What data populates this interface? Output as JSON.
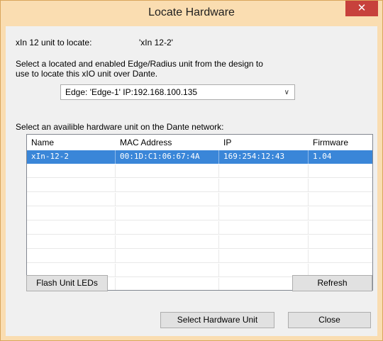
{
  "window": {
    "title": "Locate Hardware",
    "close_glyph": "✕",
    "frame_color": "#faddb1",
    "selection_color": "#3a86d8"
  },
  "locate": {
    "label": "xIn 12 unit to locate:",
    "value": "'xIn 12-2'"
  },
  "instructions": {
    "line1": "Select a located and enabled Edge/Radius unit from the design to",
    "line2": "use to locate this xIO unit over Dante."
  },
  "edge_select": {
    "value": "Edge: 'Edge-1' IP:192.168.100.135",
    "chevron": "chevron-down-icon"
  },
  "network": {
    "label": "Select an availible hardware unit on the Dante network:"
  },
  "table": {
    "headers": [
      "Name",
      "MAC Address",
      "IP",
      "Firmware"
    ],
    "rows": [
      {
        "name": "xIn-12-2",
        "mac": "00:1D:C1:06:67:4A",
        "ip": "169:254:12:43",
        "firmware": "1.04"
      }
    ]
  },
  "buttons": {
    "flash": "Flash Unit LEDs",
    "refresh": "Refresh",
    "select_hw": "Select Hardware Unit",
    "close": "Close"
  }
}
